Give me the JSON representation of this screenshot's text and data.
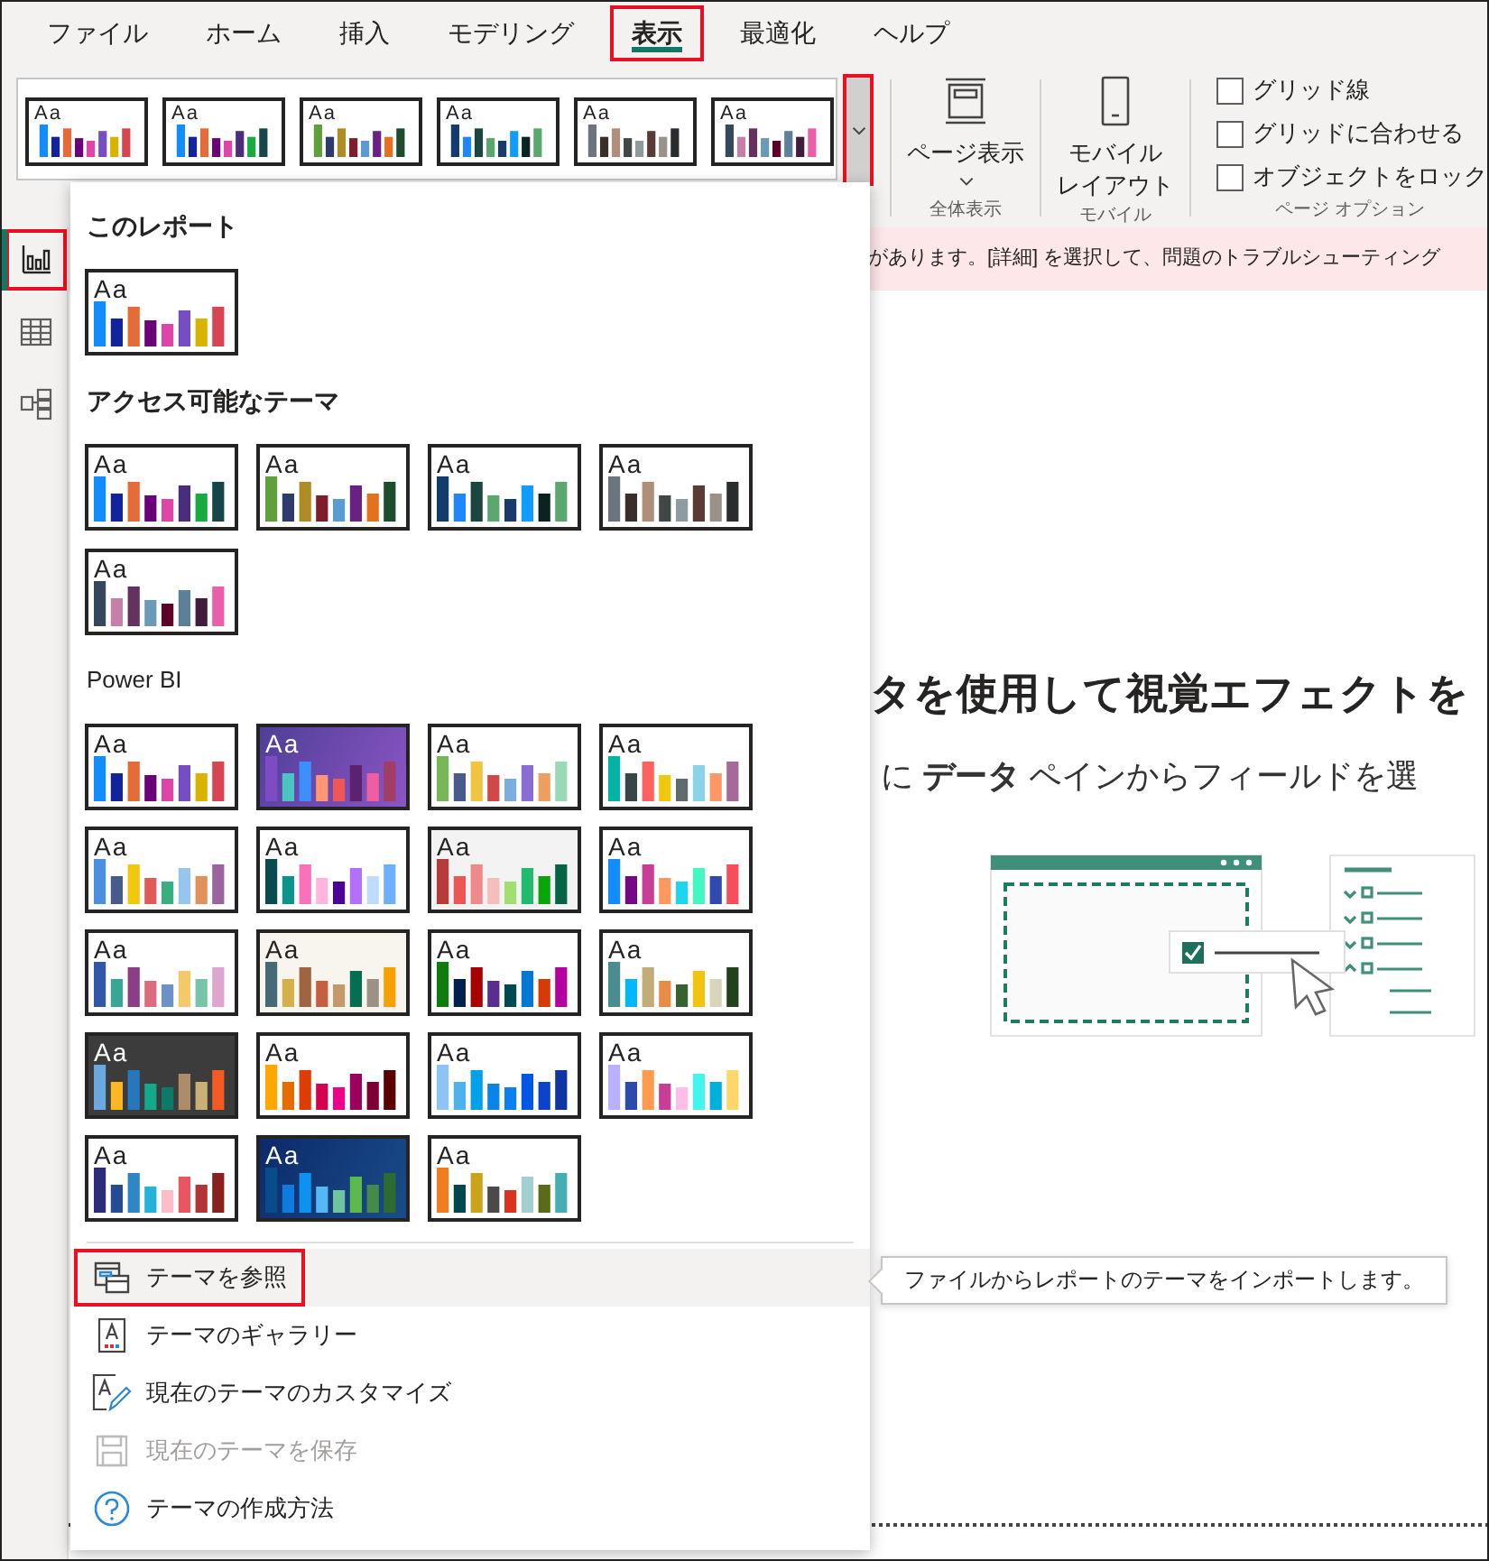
{
  "menu_tabs": [
    {
      "label": "ファイル",
      "selected": false,
      "highlighted": false
    },
    {
      "label": "ホーム",
      "selected": false,
      "highlighted": false
    },
    {
      "label": "挿入",
      "selected": false,
      "highlighted": false
    },
    {
      "label": "モデリング",
      "selected": false,
      "highlighted": false
    },
    {
      "label": "表示",
      "selected": true,
      "highlighted": true
    },
    {
      "label": "最適化",
      "selected": false,
      "highlighted": false
    },
    {
      "label": "ヘルプ",
      "selected": false,
      "highlighted": false
    }
  ],
  "ribbon": {
    "theme_gallery": {
      "themes": [
        {
          "sample": "Aa",
          "kind": "light",
          "bars": [
            {
              "color": "#118dff"
            },
            {
              "color": "#12239e"
            },
            {
              "color": "#e66c37"
            },
            {
              "color": "#6b007b"
            },
            {
              "color": "#e044a7"
            },
            {
              "color": "#744ec2"
            },
            {
              "color": "#d9b300"
            },
            {
              "color": "#d64550"
            }
          ]
        },
        {
          "sample": "Aa",
          "kind": "light",
          "bars": [
            {
              "color": "#118dff"
            },
            {
              "color": "#12239e"
            },
            {
              "color": "#e66c37"
            },
            {
              "color": "#6b007b"
            },
            {
              "color": "#e044a7"
            },
            {
              "color": "#4b2d7f"
            },
            {
              "color": "#1aab40"
            },
            {
              "color": "#15474a"
            }
          ]
        },
        {
          "sample": "Aa",
          "kind": "light",
          "bars": [
            {
              "color": "#5fa03c"
            },
            {
              "color": "#2e3b6e"
            },
            {
              "color": "#b08d24"
            },
            {
              "color": "#7f1d2a"
            },
            {
              "color": "#5a9bd4"
            },
            {
              "color": "#6b2083"
            },
            {
              "color": "#e5711e"
            },
            {
              "color": "#1d4d2c"
            }
          ]
        },
        {
          "sample": "Aa",
          "kind": "light",
          "bars": [
            {
              "color": "#123b6e"
            },
            {
              "color": "#1e87ff"
            },
            {
              "color": "#1b4640"
            },
            {
              "color": "#5aa870"
            },
            {
              "color": "#1a3a6e"
            },
            {
              "color": "#109cff"
            },
            {
              "color": "#0b2320"
            },
            {
              "color": "#5aa870"
            }
          ]
        },
        {
          "sample": "Aa",
          "kind": "light",
          "bars": [
            {
              "color": "#6c757d"
            },
            {
              "color": "#3a2e2b"
            },
            {
              "color": "#b08f7a"
            },
            {
              "color": "#3f4747"
            },
            {
              "color": "#8e9ca2"
            },
            {
              "color": "#5a3a33"
            },
            {
              "color": "#9a918b"
            },
            {
              "color": "#2a2d2d"
            }
          ]
        },
        {
          "sample": "Aa",
          "kind": "light",
          "bars": [
            {
              "color": "#35475a"
            },
            {
              "color": "#c680a8"
            },
            {
              "color": "#65315f"
            },
            {
              "color": "#6b9ab8"
            },
            {
              "color": "#5e0028"
            },
            {
              "color": "#5c7f9a"
            },
            {
              "color": "#421c3c"
            },
            {
              "color": "#ea60a8"
            }
          ]
        }
      ],
      "more_button": {
        "highlighted": true
      }
    },
    "groups": [
      {
        "kind": "buttons",
        "label": "全体表示",
        "buttons": [
          {
            "kind": "page",
            "lines": [
              "ページ表示"
            ],
            "dropdown": true
          }
        ]
      },
      {
        "kind": "buttons",
        "label": "モバイル",
        "buttons": [
          {
            "kind": "phone",
            "lines": [
              "モバイル",
              "レイアウト"
            ],
            "dropdown": false
          }
        ]
      },
      {
        "kind": "checkboxes",
        "label": "ページ オプション",
        "items": [
          {
            "label": "グリッド線",
            "checked": false
          },
          {
            "label": "グリッドに合わせる",
            "checked": false
          },
          {
            "label": "オブジェクトをロック",
            "checked": false
          }
        ]
      }
    ]
  },
  "sidebar": {
    "items": [
      {
        "kind": "report",
        "selected": true,
        "highlighted": true
      },
      {
        "kind": "table",
        "selected": false,
        "highlighted": false
      },
      {
        "kind": "model",
        "selected": false,
        "highlighted": false
      }
    ]
  },
  "warning_bar": {
    "text": "があります。[詳細] を選択して、問題のトラブルシューティング"
  },
  "canvas": {
    "heading": "タを使用して視覚エフェクトを",
    "subtext": "に **データ** ペインからフィールドを選"
  },
  "theme_menu": {
    "sections": [
      {
        "kind": "heading",
        "title": "このレポート",
        "themes": [
          {
            "sample": "Aa",
            "kind": "light",
            "bars": [
              {
                "color": "#118dff"
              },
              {
                "color": "#12239e"
              },
              {
                "color": "#e66c37"
              },
              {
                "color": "#6b007b"
              },
              {
                "color": "#e044a7"
              },
              {
                "color": "#744ec2"
              },
              {
                "color": "#d9b300"
              },
              {
                "color": "#d64550"
              }
            ]
          }
        ]
      },
      {
        "kind": "heading",
        "title": "アクセス可能なテーマ",
        "themes": [
          {
            "sample": "Aa",
            "kind": "light",
            "bars": [
              {
                "color": "#118dff"
              },
              {
                "color": "#12239e"
              },
              {
                "color": "#e66c37"
              },
              {
                "color": "#6b007b"
              },
              {
                "color": "#e044a7"
              },
              {
                "color": "#4b2d7f"
              },
              {
                "color": "#1aab40"
              },
              {
                "color": "#15474a"
              }
            ]
          },
          {
            "sample": "Aa",
            "kind": "light",
            "bars": [
              {
                "color": "#5fa03c"
              },
              {
                "color": "#2e3b6e"
              },
              {
                "color": "#b08d24"
              },
              {
                "color": "#7f1d2a"
              },
              {
                "color": "#5a9bd4"
              },
              {
                "color": "#6b2083"
              },
              {
                "color": "#e5711e"
              },
              {
                "color": "#1d4d2c"
              }
            ]
          },
          {
            "sample": "Aa",
            "kind": "light",
            "bars": [
              {
                "color": "#123b6e"
              },
              {
                "color": "#1e87ff"
              },
              {
                "color": "#1b4640"
              },
              {
                "color": "#5aa870"
              },
              {
                "color": "#1a3a6e"
              },
              {
                "color": "#109cff"
              },
              {
                "color": "#0b2320"
              },
              {
                "color": "#5aa870"
              }
            ]
          },
          {
            "sample": "Aa",
            "kind": "light",
            "bars": [
              {
                "color": "#6c757d"
              },
              {
                "color": "#3a2e2b"
              },
              {
                "color": "#b08f7a"
              },
              {
                "color": "#3f4747"
              },
              {
                "color": "#8e9ca2"
              },
              {
                "color": "#5a3a33"
              },
              {
                "color": "#9a918b"
              },
              {
                "color": "#2a2d2d"
              }
            ]
          },
          {
            "sample": "Aa",
            "kind": "light",
            "bars": [
              {
                "color": "#35475a"
              },
              {
                "color": "#c680a8"
              },
              {
                "color": "#65315f"
              },
              {
                "color": "#6b9ab8"
              },
              {
                "color": "#5e0028"
              },
              {
                "color": "#5c7f9a"
              },
              {
                "color": "#421c3c"
              },
              {
                "color": "#ea60a8"
              }
            ]
          }
        ]
      },
      {
        "kind": "label",
        "title": "Power BI",
        "themes": [
          {
            "sample": "Aa",
            "kind": "light",
            "bars": [
              {
                "color": "#118dff"
              },
              {
                "color": "#12239e"
              },
              {
                "color": "#e66c37"
              },
              {
                "color": "#6b007b"
              },
              {
                "color": "#e044a7"
              },
              {
                "color": "#744ec2"
              },
              {
                "color": "#d9b300"
              },
              {
                "color": "#d64550"
              }
            ]
          },
          {
            "sample": "Aa",
            "kind": "violet",
            "bars": [
              {
                "color": "#7d4cc4"
              },
              {
                "color": "#4dc4c4"
              },
              {
                "color": "#3d8fff"
              },
              {
                "color": "#ff9773"
              },
              {
                "color": "#ef5757"
              },
              {
                "color": "#5c2270"
              },
              {
                "color": "#ef5fa0"
              },
              {
                "color": "#a23e66"
              }
            ]
          },
          {
            "sample": "Aa",
            "kind": "light",
            "bars": [
              {
                "color": "#77b75a"
              },
              {
                "color": "#4a5a8b"
              },
              {
                "color": "#efc53f"
              },
              {
                "color": "#d04848"
              },
              {
                "color": "#7aaee0"
              },
              {
                "color": "#8b6cd4"
              },
              {
                "color": "#ed9e61"
              },
              {
                "color": "#9ad9b8"
              }
            ]
          },
          {
            "sample": "Aa",
            "kind": "light",
            "bars": [
              {
                "color": "#02b3a6"
              },
              {
                "color": "#374649"
              },
              {
                "color": "#fd625e"
              },
              {
                "color": "#f2c80f"
              },
              {
                "color": "#5f6b6d"
              },
              {
                "color": "#8ad4eb"
              },
              {
                "color": "#fe9666"
              },
              {
                "color": "#a66999"
              }
            ]
          },
          {
            "sample": "Aa",
            "kind": "light",
            "bars": [
              {
                "color": "#4a8fe0"
              },
              {
                "color": "#4a5a8b"
              },
              {
                "color": "#f2c80f"
              },
              {
                "color": "#e05a5a"
              },
              {
                "color": "#3aae7e"
              },
              {
                "color": "#96c6f0"
              },
              {
                "color": "#e0915e"
              },
              {
                "color": "#9b64a0"
              }
            ]
          },
          {
            "sample": "Aa",
            "kind": "light",
            "bars": [
              {
                "color": "#0a4b4f"
              },
              {
                "color": "#0a948c"
              },
              {
                "color": "#fb70ba"
              },
              {
                "color": "#ffb5dd"
              },
              {
                "color": "#4b0096"
              },
              {
                "color": "#b56ffd"
              },
              {
                "color": "#bddcff"
              },
              {
                "color": "#6cb0ff"
              }
            ]
          },
          {
            "sample": "Aa",
            "kind": "grey",
            "bars": [
              {
                "color": "#b83b3b"
              },
              {
                "color": "#ee5555"
              },
              {
                "color": "#f08a8a"
              },
              {
                "color": "#f7bcbc"
              },
              {
                "color": "#a0e070"
              },
              {
                "color": "#22bb6e"
              },
              {
                "color": "#0aa50a"
              },
              {
                "color": "#056445"
              }
            ]
          },
          {
            "sample": "Aa",
            "kind": "light",
            "bars": [
              {
                "color": "#118dff"
              },
              {
                "color": "#750985"
              },
              {
                "color": "#c83d95"
              },
              {
                "color": "#ff985e"
              },
              {
                "color": "#1dd5ee"
              },
              {
                "color": "#42f7c0"
              },
              {
                "color": "#3049ad"
              },
              {
                "color": "#f64f5c"
              }
            ]
          },
          {
            "sample": "Aa",
            "kind": "light",
            "bars": [
              {
                "color": "#3257a8"
              },
              {
                "color": "#37a794"
              },
              {
                "color": "#8b3d88"
              },
              {
                "color": "#dd6b7f"
              },
              {
                "color": "#6b91c9"
              },
              {
                "color": "#f5c869"
              },
              {
                "color": "#77c4a8"
              },
              {
                "color": "#dea6cf"
              }
            ]
          },
          {
            "sample": "Aa",
            "kind": "cream",
            "bars": [
              {
                "color": "#456a76"
              },
              {
                "color": "#d4b04b"
              },
              {
                "color": "#a06440"
              },
              {
                "color": "#c55f3f"
              },
              {
                "color": "#c49a6c"
              },
              {
                "color": "#027050"
              },
              {
                "color": "#9d9186"
              },
              {
                "color": "#f5a200"
              }
            ]
          },
          {
            "sample": "Aa",
            "kind": "light",
            "bars": [
              {
                "color": "#107c10"
              },
              {
                "color": "#002050"
              },
              {
                "color": "#a80000"
              },
              {
                "color": "#5c2d91"
              },
              {
                "color": "#004b50"
              },
              {
                "color": "#0078d7"
              },
              {
                "color": "#d83b01"
              },
              {
                "color": "#b4009e"
              }
            ]
          },
          {
            "sample": "Aa",
            "kind": "light",
            "bars": [
              {
                "color": "#4a8d90"
              },
              {
                "color": "#01b8ff"
              },
              {
                "color": "#c4ac78"
              },
              {
                "color": "#ea8b45"
              },
              {
                "color": "#376131"
              },
              {
                "color": "#f2c40f"
              },
              {
                "color": "#d9d5bb"
              },
              {
                "color": "#22421c"
              }
            ]
          },
          {
            "sample": "Aa",
            "kind": "dark",
            "bars": [
              {
                "color": "#6aa8e0"
              },
              {
                "color": "#feb721"
              },
              {
                "color": "#2677bd"
              },
              {
                "color": "#13a98b"
              },
              {
                "color": "#0c7a68"
              },
              {
                "color": "#ad8c6a"
              },
              {
                "color": "#c9b176"
              },
              {
                "color": "#f45a24"
              }
            ]
          },
          {
            "sample": "Aa",
            "kind": "light",
            "bars": [
              {
                "color": "#ffa600"
              },
              {
                "color": "#e66c00"
              },
              {
                "color": "#dd3d00"
              },
              {
                "color": "#d40050"
              },
              {
                "color": "#ee008b"
              },
              {
                "color": "#9b005f"
              },
              {
                "color": "#7e0033"
              },
              {
                "color": "#5a0000"
              }
            ]
          },
          {
            "sample": "Aa",
            "kind": "light",
            "bars": [
              {
                "color": "#8cc5f5"
              },
              {
                "color": "#4cb3f0"
              },
              {
                "color": "#00a0ea"
              },
              {
                "color": "#0b84e8"
              },
              {
                "color": "#0a7ff0"
              },
              {
                "color": "#0057e6"
              },
              {
                "color": "#0d43c9"
              },
              {
                "color": "#0f35a3"
              }
            ]
          },
          {
            "sample": "Aa",
            "kind": "light",
            "bars": [
              {
                "color": "#b9b1fd"
              },
              {
                "color": "#2e4aab"
              },
              {
                "color": "#fe9b4f"
              },
              {
                "color": "#c83d95"
              },
              {
                "color": "#ffbde9"
              },
              {
                "color": "#42f5f0"
              },
              {
                "color": "#00b0dc"
              },
              {
                "color": "#fed76a"
              }
            ]
          },
          {
            "sample": "Aa",
            "kind": "light",
            "bars": [
              {
                "color": "#2b2d7b"
              },
              {
                "color": "#244b94"
              },
              {
                "color": "#2f86c6"
              },
              {
                "color": "#25b1d9"
              },
              {
                "color": "#fdbcc8"
              },
              {
                "color": "#ea5560"
              },
              {
                "color": "#b23434"
              },
              {
                "color": "#8a1f1f"
              }
            ]
          },
          {
            "sample": "Aa",
            "kind": "ocean",
            "bars": [
              {
                "color": "#0a4b8b"
              },
              {
                "color": "#0e7be0"
              },
              {
                "color": "#0e92f0"
              },
              {
                "color": "#55b8f5"
              },
              {
                "color": "#6ec4a0"
              },
              {
                "color": "#5aba4c"
              },
              {
                "color": "#468a48"
              },
              {
                "color": "#2d6b30"
              }
            ]
          },
          {
            "sample": "Aa",
            "kind": "light",
            "bars": [
              {
                "color": "#ef7d22"
              },
              {
                "color": "#00484e"
              },
              {
                "color": "#cba31b"
              },
              {
                "color": "#4a4a4a"
              },
              {
                "color": "#d9321f"
              },
              {
                "color": "#a4cfd1"
              },
              {
                "color": "#5b6b1a"
              },
              {
                "color": "#45aeb2"
              }
            ]
          }
        ]
      }
    ],
    "actions": [
      {
        "kind": "browse",
        "label": "テーマを参照",
        "hovered": true,
        "highlighted": true,
        "disabled": false
      },
      {
        "kind": "gallery",
        "label": "テーマのギャラリー",
        "hovered": false,
        "highlighted": false,
        "disabled": false
      },
      {
        "kind": "customize",
        "label": "現在のテーマのカスタマイズ",
        "hovered": false,
        "highlighted": false,
        "disabled": false
      },
      {
        "kind": "save",
        "label": "現在のテーマを保存",
        "hovered": false,
        "highlighted": false,
        "disabled": true
      },
      {
        "kind": "help",
        "label": "テーマの作成方法",
        "hovered": false,
        "highlighted": false,
        "disabled": false
      }
    ]
  },
  "tooltip": {
    "text": "ファイルからレポートのテーマをインポートします。"
  }
}
